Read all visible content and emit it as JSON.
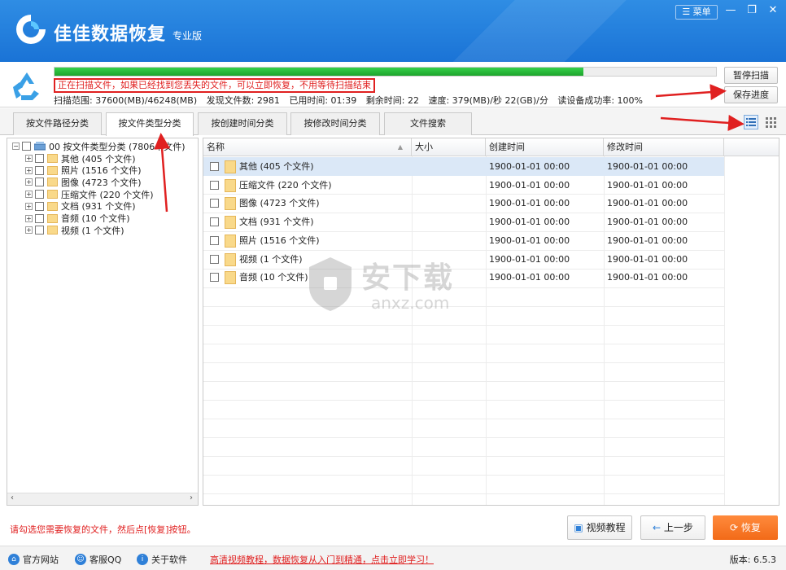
{
  "window": {
    "title": "佳佳数据恢复",
    "edition": "专业版",
    "menu_label": "菜单",
    "minimize_glyph": "—",
    "restore_glyph": "❐",
    "close_glyph": "✕"
  },
  "scan": {
    "progress_fraction": 0.8,
    "message": "正在扫描文件，如果已经找到您丢失的文件，可以立即恢复，不用等待扫描结束",
    "range": "扫描范围: 37600(MB)/46248(MB)",
    "found": "发现文件数: 2981",
    "elapsed": "已用时间: 01:39",
    "remaining": "剩余时间: 22",
    "speed": "速度: 379(MB)/秒  22(GB)/分",
    "success_rate": "读设备成功率: 100%",
    "pause_label": "暂停扫描",
    "save_label": "保存进度"
  },
  "tabs": [
    {
      "label": "按文件路径分类",
      "active": false
    },
    {
      "label": "按文件类型分类",
      "active": true
    },
    {
      "label": "按创建时间分类",
      "active": false
    },
    {
      "label": "按修改时间分类",
      "active": false
    },
    {
      "label": "文件搜索",
      "active": false
    }
  ],
  "tree": {
    "root_label": "00  按文件类型分类    (7806个文件)",
    "items": [
      {
        "label": "其他      (405 个文件)"
      },
      {
        "label": "照片      (1516 个文件)"
      },
      {
        "label": "图像      (4723 个文件)"
      },
      {
        "label": "压缩文件    (220 个文件)"
      },
      {
        "label": "文档      (931 个文件)"
      },
      {
        "label": "音频      (10 个文件)"
      },
      {
        "label": "视频      (1 个文件)"
      }
    ],
    "scroll_left": "‹",
    "scroll_right": "›"
  },
  "list": {
    "columns": [
      "名称",
      "大小",
      "创建时间",
      "修改时间"
    ],
    "sort_glyph": "▲",
    "rows": [
      {
        "name": "其他   (405 个文件)",
        "size": "",
        "created": "1900-01-01  00:00",
        "modified": "1900-01-01  00:00",
        "selected": true
      },
      {
        "name": "压缩文件   (220 个文件)",
        "size": "",
        "created": "1900-01-01  00:00",
        "modified": "1900-01-01  00:00",
        "selected": false
      },
      {
        "name": "图像   (4723 个文件)",
        "size": "",
        "created": "1900-01-01  00:00",
        "modified": "1900-01-01  00:00",
        "selected": false
      },
      {
        "name": "文档   (931 个文件)",
        "size": "",
        "created": "1900-01-01  00:00",
        "modified": "1900-01-01  00:00",
        "selected": false
      },
      {
        "name": "照片   (1516 个文件)",
        "size": "",
        "created": "1900-01-01  00:00",
        "modified": "1900-01-01  00:00",
        "selected": false
      },
      {
        "name": "视频   (1 个文件)",
        "size": "",
        "created": "1900-01-01  00:00",
        "modified": "1900-01-01  00:00",
        "selected": false
      },
      {
        "name": "音频   (10 个文件)",
        "size": "",
        "created": "1900-01-01  00:00",
        "modified": "1900-01-01  00:00",
        "selected": false
      }
    ]
  },
  "watermark": {
    "text": "安下载",
    "sub": "anxz.com"
  },
  "bottom": {
    "hint": "请勾选您需要恢复的文件，然后点[恢复]按钮。",
    "video_label": "视频教程",
    "back_label": "上一步",
    "recover_label": "恢复"
  },
  "footer": {
    "site": "官方网站",
    "qq": "客服QQ",
    "about": "关于软件",
    "promo": "高清视频教程，数据恢复从入门到精通，点击立即学习！",
    "version": "版本: 6.5.3"
  },
  "colors": {
    "accent": "#1a73d6",
    "alert": "#e02020",
    "progress": "#22b033",
    "recover": "#f26a18"
  }
}
